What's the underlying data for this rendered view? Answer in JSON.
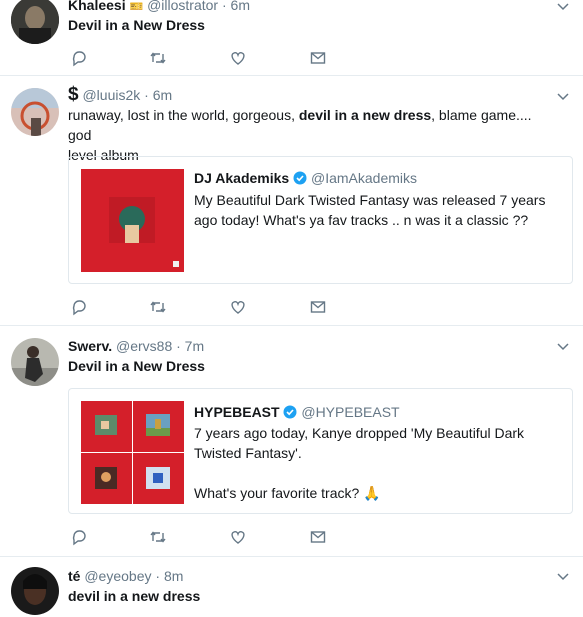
{
  "tweets": [
    {
      "name": "Khaleesi",
      "emoji": "🎫",
      "handle": "@illostrator",
      "time": "· 6m",
      "text_bold": "Devil in a New Dress"
    },
    {
      "name": "$",
      "handle": "@luuis2k",
      "time": "· 6m",
      "text_pre": "runaway, lost in the world, gorgeous, ",
      "text_bold": "devil in a new dress",
      "text_post_line1": ", blame game.... god",
      "text_post_line2": "level album",
      "quote": {
        "name": "DJ Akademiks",
        "handle": "@IamAkademiks",
        "line1": "My Beautiful Dark Twisted Fantasy was released 7 years",
        "line2": "ago today! What's ya fav tracks .. n was it a classic ??"
      }
    },
    {
      "name": "Swerv.",
      "handle": "@ervs88",
      "time": "· 7m",
      "text_bold": "Devil in a New Dress",
      "quote": {
        "name": "HYPEBEAST",
        "handle": "@HYPEBEAST",
        "line1": "7 years ago today, Kanye dropped 'My Beautiful Dark",
        "line2": "Twisted Fantasy'.",
        "line3": "What's your favorite track? 🙏"
      }
    },
    {
      "name": "té",
      "handle": "@eyeobey",
      "time": "· 8m",
      "text_bold": "devil in a new dress"
    }
  ],
  "colors": {
    "accent": "#1da1f2",
    "muted": "#657786",
    "album_red": "#d41f2a"
  },
  "icons": [
    "reply-icon",
    "retweet-icon",
    "like-icon",
    "message-icon",
    "chevron-down-icon",
    "verified-icon"
  ]
}
